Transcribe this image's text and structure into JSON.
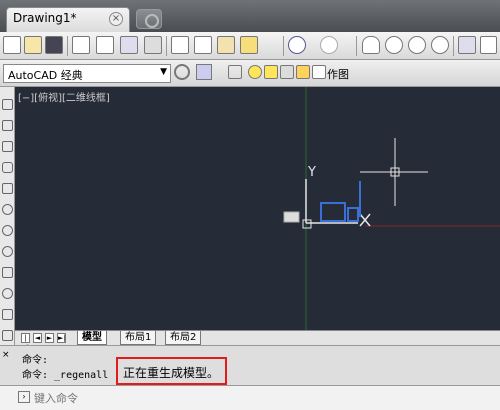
{
  "tab": {
    "title": "Drawing1*",
    "close": "×"
  },
  "workspace": {
    "selected": "AutoCAD 经典",
    "arrow": "▼"
  },
  "layer": {
    "name": "作图"
  },
  "viewport": {
    "label": "[−][俯视][二维线框]"
  },
  "layout_tabs": [
    "模型",
    "布局1",
    "布局2"
  ],
  "command": {
    "history": [
      "命令:",
      "命令: _regenall"
    ],
    "status": "正在重生成模型。",
    "placeholder": "键入命令"
  },
  "colors": {
    "canvas": "#252b37",
    "highlight": "#e21b1b",
    "ucs": "#e6e6e6",
    "selection": "#3a6fd8",
    "x_axis": "#8a2424",
    "y_axis": "#2d6a2d"
  },
  "icons": [
    "new-icon",
    "open-icon",
    "save-icon",
    "print-icon",
    "preview-icon",
    "publish-icon",
    "3d-print-icon",
    "cut-icon",
    "copy-icon",
    "paste-icon",
    "match-properties-icon",
    "undo-icon",
    "redo-icon",
    "pan-icon",
    "zoom-realtime-icon",
    "zoom-window-icon",
    "zoom-previous-icon",
    "properties-icon",
    "design-center-icon"
  ]
}
